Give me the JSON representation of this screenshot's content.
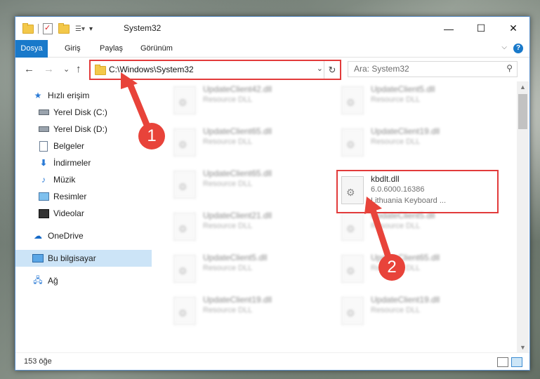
{
  "window": {
    "title": "System32",
    "minimize_glyph": "—",
    "maximize_glyph": "☐",
    "close_glyph": "✕"
  },
  "ribbon": {
    "tabs": [
      "Dosya",
      "Giriş",
      "Paylaş",
      "Görünüm"
    ],
    "help_glyph": "?",
    "collapse_glyph": "⌵"
  },
  "navbar": {
    "address": "C:\\Windows\\System32",
    "search_placeholder": "Ara: System32",
    "back_glyph": "←",
    "forward_glyph": "→",
    "recent_glyph": "⌄",
    "up_glyph": "↑",
    "refresh_glyph": "↻",
    "dropdown_glyph": "⌄",
    "search_glyph": "⚲"
  },
  "sidebar": {
    "items": [
      {
        "label": "Hızlı erişim",
        "icon": "star-icon"
      },
      {
        "label": "Yerel Disk (C:)",
        "icon": "drive-icon"
      },
      {
        "label": "Yerel Disk (D:)",
        "icon": "drive-icon"
      },
      {
        "label": "Belgeler",
        "icon": "documents-icon"
      },
      {
        "label": "İndirmeler",
        "icon": "download-icon"
      },
      {
        "label": "Müzik",
        "icon": "music-icon"
      },
      {
        "label": "Resimler",
        "icon": "pictures-icon"
      },
      {
        "label": "Videolar",
        "icon": "video-icon"
      },
      {
        "label": "OneDrive",
        "icon": "cloud-icon"
      },
      {
        "label": "Bu bilgisayar",
        "icon": "computer-icon"
      },
      {
        "label": "Ağ",
        "icon": "network-icon"
      }
    ]
  },
  "files": [
    {
      "name": "UpdateClient42.dll",
      "type": "Resource DLL"
    },
    {
      "name": "UpdateClient5.dll",
      "type": "Resource DLL"
    },
    {
      "name": "UpdateClient65.dll",
      "type": "Resource DLL"
    },
    {
      "name": "UpdateClient19.dll",
      "type": "Resource DLL"
    },
    {
      "name": "UpdateClient65.dll",
      "type": "Resource DLL"
    },
    {
      "name": "kbdlt.dll",
      "version": "6.0.6000.16386",
      "description": "Lithuania Keyboard ..."
    },
    {
      "name": "UpdateClient21.dll",
      "type": "Resource DLL"
    },
    {
      "name": "UpdateClient5.dll",
      "type": "Resource DLL"
    },
    {
      "name": "UpdateClient5.dll",
      "type": "Resource DLL"
    },
    {
      "name": "UpdateClient65.dll",
      "type": "Resource DLL"
    },
    {
      "name": "UpdateClient19.dll",
      "type": "Resource DLL"
    },
    {
      "name": "UpdateClient19.dll",
      "type": "Resource DLL"
    }
  ],
  "status": {
    "item_count": "153 öğe"
  },
  "annotations": {
    "step1": "1",
    "step2": "2",
    "color": "#e8433a"
  }
}
